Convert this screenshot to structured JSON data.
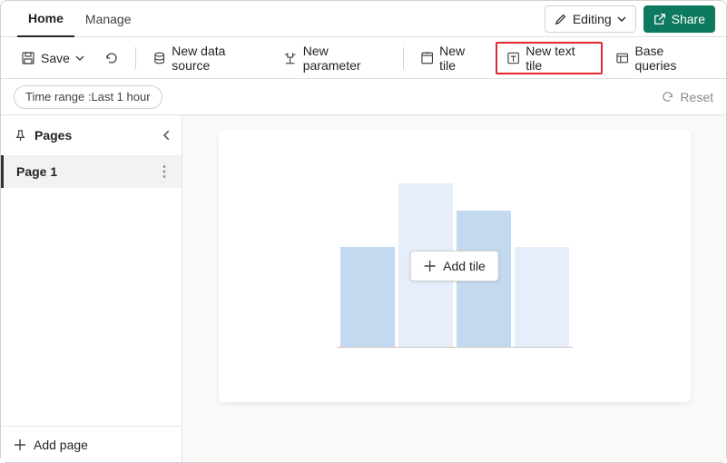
{
  "tabs": {
    "home": "Home",
    "manage": "Manage"
  },
  "header": {
    "editing": "Editing",
    "share": "Share"
  },
  "toolbar": {
    "save": "Save",
    "new_data_source": "New data source",
    "new_parameter": "New parameter",
    "new_tile": "New tile",
    "new_text_tile": "New text tile",
    "base_queries": "Base queries"
  },
  "filter": {
    "time_range_label": "Time range : ",
    "time_range_value": "Last 1 hour",
    "reset": "Reset"
  },
  "sidebar": {
    "title": "Pages",
    "page1": "Page 1",
    "add_page": "Add page"
  },
  "canvas": {
    "add_tile": "Add tile"
  },
  "chart_data": {
    "type": "bar",
    "categories": [
      "",
      "",
      "",
      ""
    ],
    "values": [
      110,
      180,
      150,
      110
    ],
    "title": "",
    "xlabel": "",
    "ylabel": "",
    "ylim": [
      0,
      180
    ]
  }
}
